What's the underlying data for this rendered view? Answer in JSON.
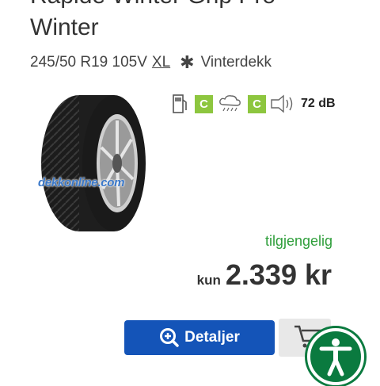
{
  "product": {
    "title_partial": "Rapide Winter Grip Pro",
    "title": "Winter",
    "size": "245/50 R19 105V",
    "load_flag": "XL",
    "season_icon": "snowflake-icon",
    "season": "Vinterdekk",
    "watermark": "dekkonline.com"
  },
  "eu_label": {
    "fuel_grade": "C",
    "wet_grade": "C",
    "noise": "72 dB",
    "grade_color": "#8dc63f"
  },
  "availability": "tilgjengelig",
  "price": {
    "prefix": "kun",
    "value": "2.339 kr"
  },
  "actions": {
    "details_label": "Detaljer",
    "details_color": "#1454b8",
    "cart_icon": "cart-add-icon",
    "accessibility_icon": "accessibility-icon"
  }
}
